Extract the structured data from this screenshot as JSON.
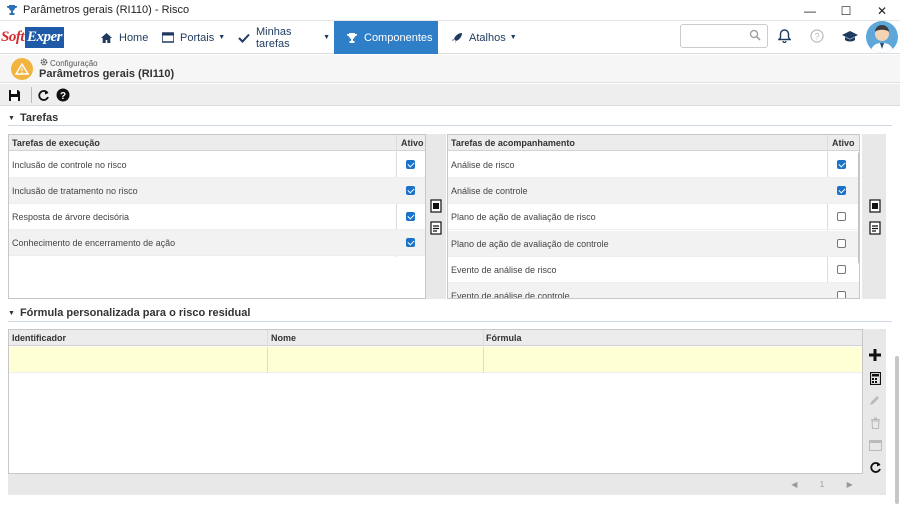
{
  "window": {
    "title": "Parâmetros gerais (RI110) - Risco",
    "controls": [
      "minimize",
      "maximize",
      "close"
    ]
  },
  "navbar": {
    "logo_part1": "Soft",
    "logo_part2": "Exper",
    "items": [
      {
        "label": "Home",
        "icon": "home-icon"
      },
      {
        "label": "Portais",
        "icon": "portals-icon"
      },
      {
        "label": "Minhas tarefas",
        "icon": "check-icon"
      },
      {
        "label": "Componentes",
        "icon": "trophy-icon",
        "active": true
      },
      {
        "label": "Atalhos",
        "icon": "rocket-icon"
      }
    ],
    "search_placeholder": ""
  },
  "header": {
    "breadcrumb": "Configuração",
    "title": "Parâmetros gerais (RI110)"
  },
  "sections": {
    "tarefas": "Tarefas",
    "formula": "Fórmula personalizada para o risco residual"
  },
  "execucao": {
    "col_name": "Tarefas de execução",
    "col_active": "Ativo",
    "rows": [
      {
        "label": "Inclusão de controle no risco",
        "active": true
      },
      {
        "label": "Inclusão de tratamento no risco",
        "active": true
      },
      {
        "label": "Resposta de árvore decisória",
        "active": true
      },
      {
        "label": "Conhecimento de encerramento de ação",
        "active": true
      }
    ]
  },
  "acompanhamento": {
    "col_name": "Tarefas de acompanhamento",
    "col_active": "Ativo",
    "rows": [
      {
        "label": "Análise de risco",
        "active": true
      },
      {
        "label": "Análise de controle",
        "active": true
      },
      {
        "label": "Plano de ação de avaliação de risco",
        "active": false
      },
      {
        "label": "Plano de ação de avaliação de controle",
        "active": false
      },
      {
        "label": "Evento de análise de risco",
        "active": false
      },
      {
        "label": "Evento de análise de controle",
        "active": false
      }
    ]
  },
  "formula_table": {
    "columns": [
      "Identificador",
      "Nome",
      "Fórmula"
    ],
    "page": "1"
  },
  "colors": {
    "accent": "#2f7fc8",
    "checkbox": "#1a73c9",
    "selected_row": "#ffffd5",
    "header_icon": "#f0b43f"
  }
}
